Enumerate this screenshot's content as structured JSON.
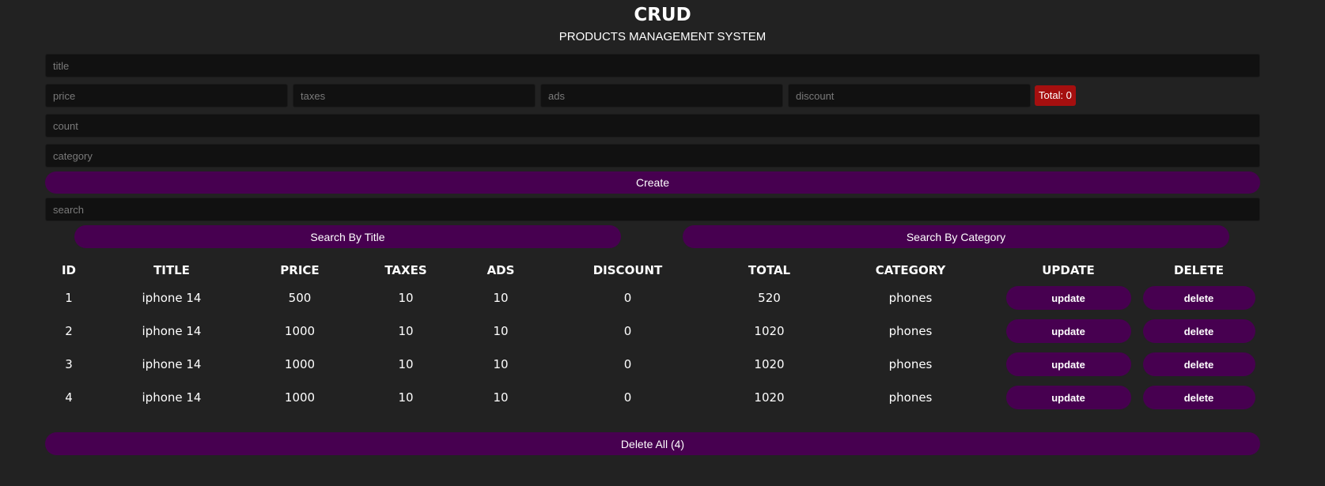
{
  "header": {
    "title": "CRUD",
    "subtitle": "PRODUCTS MANAGEMENT SYSTEM"
  },
  "form": {
    "title_placeholder": "title",
    "price_placeholder": "price",
    "taxes_placeholder": "taxes",
    "ads_placeholder": "ads",
    "discount_placeholder": "discount",
    "total_label": "Total: 0",
    "count_placeholder": "count",
    "category_placeholder": "category",
    "create_label": "Create"
  },
  "search": {
    "placeholder": "search",
    "by_title_label": "Search By Title",
    "by_category_label": "Search By Category"
  },
  "table": {
    "headers": [
      "ID",
      "TITLE",
      "PRICE",
      "TAXES",
      "ADS",
      "DISCOUNT",
      "TOTAL",
      "CATEGORY",
      "UPDATE",
      "DELETE"
    ],
    "rows": [
      {
        "id": "1",
        "title": "iphone 14",
        "price": "500",
        "taxes": "10",
        "ads": "10",
        "discount": "0",
        "total": "520",
        "category": "phones",
        "update": "update",
        "delete": "delete"
      },
      {
        "id": "2",
        "title": "iphone 14",
        "price": "1000",
        "taxes": "10",
        "ads": "10",
        "discount": "0",
        "total": "1020",
        "category": "phones",
        "update": "update",
        "delete": "delete"
      },
      {
        "id": "3",
        "title": "iphone 14",
        "price": "1000",
        "taxes": "10",
        "ads": "10",
        "discount": "0",
        "total": "1020",
        "category": "phones",
        "update": "update",
        "delete": "delete"
      },
      {
        "id": "4",
        "title": "iphone 14",
        "price": "1000",
        "taxes": "10",
        "ads": "10",
        "discount": "0",
        "total": "1020",
        "category": "phones",
        "update": "update",
        "delete": "delete"
      }
    ]
  },
  "delete_all_label": "Delete All (4)",
  "colors": {
    "background": "#222222",
    "input_bg": "#111111",
    "button": "#470050",
    "total_badge": "#a50f0f"
  }
}
